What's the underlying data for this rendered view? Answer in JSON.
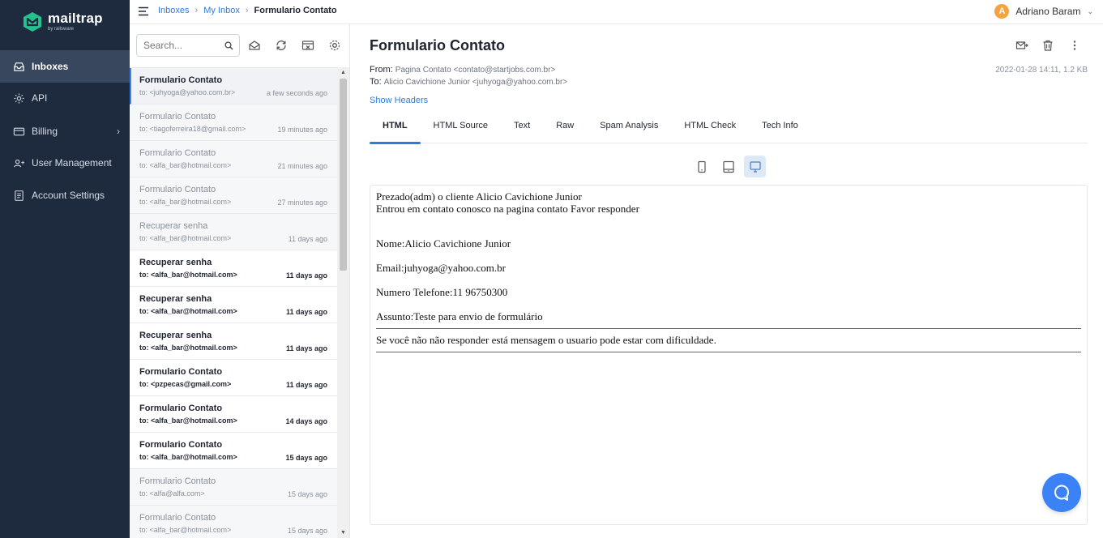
{
  "brand": {
    "name": "mailtrap",
    "sub": "by railsware",
    "accent": "#2e7be0",
    "nav_bg": "#1e2b3f"
  },
  "nav": {
    "items": [
      {
        "label": "Inboxes",
        "icon": "inbox-icon",
        "active": true
      },
      {
        "label": "API",
        "icon": "gear-icon"
      },
      {
        "label": "Billing",
        "icon": "card-icon",
        "has_chevron": true
      },
      {
        "label": "User Management",
        "icon": "users-icon"
      },
      {
        "label": "Account Settings",
        "icon": "document-icon"
      }
    ],
    "chevron": "›"
  },
  "topbar": {
    "crumbs": [
      "Inboxes",
      "My Inbox",
      "Formulario Contato"
    ],
    "sep": "›",
    "user": {
      "initial": "A",
      "name": "Adriano Baram",
      "caret": "⌄"
    }
  },
  "list": {
    "search_placeholder": "Search...",
    "messages": [
      {
        "subject": "Formulario Contato",
        "to": "to: <juhyoga@yahoo.com.br>",
        "time": "a few seconds ago",
        "state": "selected"
      },
      {
        "subject": "Formulario Contato",
        "to": "to: <tiagoferreira18@gmail.com>",
        "time": "19 minutes ago",
        "state": "read"
      },
      {
        "subject": "Formulario Contato",
        "to": "to: <alfa_bar@hotmail.com>",
        "time": "21 minutes ago",
        "state": "read"
      },
      {
        "subject": "Formulario Contato",
        "to": "to: <alfa_bar@hotmail.com>",
        "time": "27 minutes ago",
        "state": "read"
      },
      {
        "subject": "Recuperar senha",
        "to": "to: <alfa_bar@hotmail.com>",
        "time": "11 days ago",
        "state": "read"
      },
      {
        "subject": "Recuperar senha",
        "to": "to: <alfa_bar@hotmail.com>",
        "time": "11 days ago",
        "state": "unread"
      },
      {
        "subject": "Recuperar senha",
        "to": "to: <alfa_bar@hotmail.com>",
        "time": "11 days ago",
        "state": "unread"
      },
      {
        "subject": "Recuperar senha",
        "to": "to: <alfa_bar@hotmail.com>",
        "time": "11 days ago",
        "state": "unread"
      },
      {
        "subject": "Formulario Contato",
        "to": "to: <pzpecas@gmail.com>",
        "time": "11 days ago",
        "state": "unread"
      },
      {
        "subject": "Formulario Contato",
        "to": "to: <alfa_bar@hotmail.com>",
        "time": "14 days ago",
        "state": "unread"
      },
      {
        "subject": "Formulario Contato",
        "to": "to: <alfa_bar@hotmail.com>",
        "time": "15 days ago",
        "state": "unread"
      },
      {
        "subject": "Formulario Contato",
        "to": "to: <alfa@alfa.com>",
        "time": "15 days ago",
        "state": "read"
      },
      {
        "subject": "Formulario Contato",
        "to": "to: <alfa_bar@hotmail.com>",
        "time": "15 days ago",
        "state": "read"
      }
    ]
  },
  "viewer": {
    "title": "Formulario Contato",
    "from_label": "From:",
    "from": "Pagina Contato <contato@startjobs.com.br>",
    "to_label": "To:",
    "to": "Alicio Cavichione Junior <juhyoga@yahoo.com.br>",
    "meta": "2022-01-28 14:11, 1.2 KB",
    "show_headers": "Show Headers",
    "tabs": [
      "HTML",
      "HTML Source",
      "Text",
      "Raw",
      "Spam Analysis",
      "HTML Check",
      "Tech Info"
    ],
    "active_tab": "HTML",
    "body": {
      "line1": "Prezado(adm) o cliente Alicio Cavichione Junior",
      "line2": "Entrou em contato conosco na pagina contato Favor responder",
      "nome": "Nome:Alicio Cavichione Junior",
      "email": "Email:juhyoga@yahoo.com.br",
      "telefone": "Numero Telefone:11 96750300",
      "assunto": "Assunto:Teste para envio de formulário",
      "aviso": "Se você não não responder está mensagem o usuario pode estar com dificuldade."
    }
  }
}
